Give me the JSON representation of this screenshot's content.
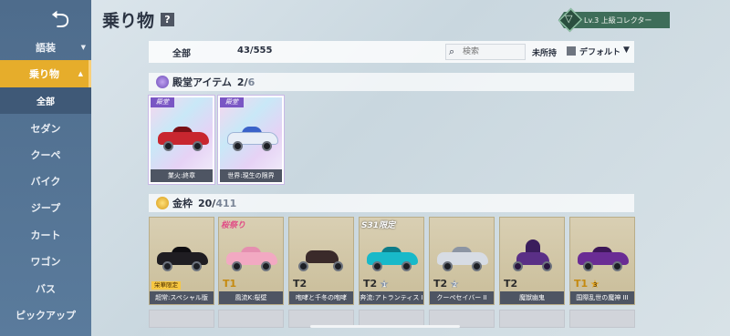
{
  "header": {
    "title": "乗り物",
    "help": "?",
    "level_label": "Lv.3 上級コレクター"
  },
  "sidebar": {
    "back": "⮌",
    "items": [
      {
        "label": "語装",
        "arrow": "▼"
      },
      {
        "label": "乗り物",
        "arrow": "▲"
      },
      {
        "label": "全部"
      },
      {
        "label": "セダン"
      },
      {
        "label": "クーペ"
      },
      {
        "label": "バイク"
      },
      {
        "label": "ジープ"
      },
      {
        "label": "カート"
      },
      {
        "label": "ワゴン"
      },
      {
        "label": "バス"
      },
      {
        "label": "ピックアップ"
      }
    ]
  },
  "filter": {
    "all_label": "全部",
    "count": "43/555",
    "search_placeholder": "検索",
    "unowned_label": "未所持",
    "default_label": "デフォルト",
    "dropdown": "▼"
  },
  "sections": {
    "hall": {
      "title": "殿堂アイテム",
      "owned": "2/",
      "total": "6"
    },
    "gold": {
      "title": "金枠",
      "owned": "20/",
      "total": "411"
    }
  },
  "hall_items": [
    {
      "tag": "殿堂",
      "caption": "業火:終章",
      "color": "#c8262f"
    },
    {
      "tag": "殿堂",
      "caption": "世界:現生の限界",
      "color": "#e8eef7"
    }
  ],
  "gold_items": [
    {
      "caption": "超常:スペシャル版",
      "banner": "",
      "tier": "",
      "limited": "栄華限定",
      "star": "",
      "color": "#1f1d22"
    },
    {
      "caption": "風流K:桜壁",
      "banner": "桜祭り",
      "tier": "T1",
      "limited": "",
      "star": "",
      "color": "#f2a9c2"
    },
    {
      "caption": "咆哮と千冬の咆哮",
      "banner": "",
      "tier": "T2",
      "limited": "",
      "star": "",
      "color": "#3a2a2a"
    },
    {
      "caption": "奔流:アトランティス I",
      "banner": "S31限定",
      "tier": "T2",
      "limited": "",
      "star": "1",
      "color": "#18b9c9"
    },
    {
      "caption": "クーペセイバー II",
      "banner": "",
      "tier": "T2",
      "limited": "",
      "star": "2",
      "color": "#d7dce4"
    },
    {
      "caption": "魔獣幽鬼",
      "banner": "",
      "tier": "T2",
      "limited": "",
      "star": "",
      "color": "#5a2f86"
    },
    {
      "caption": "国際乱世の魔神 III",
      "banner": "",
      "tier": "T1",
      "limited": "",
      "star": "3",
      "color": "#6a2c94"
    }
  ]
}
